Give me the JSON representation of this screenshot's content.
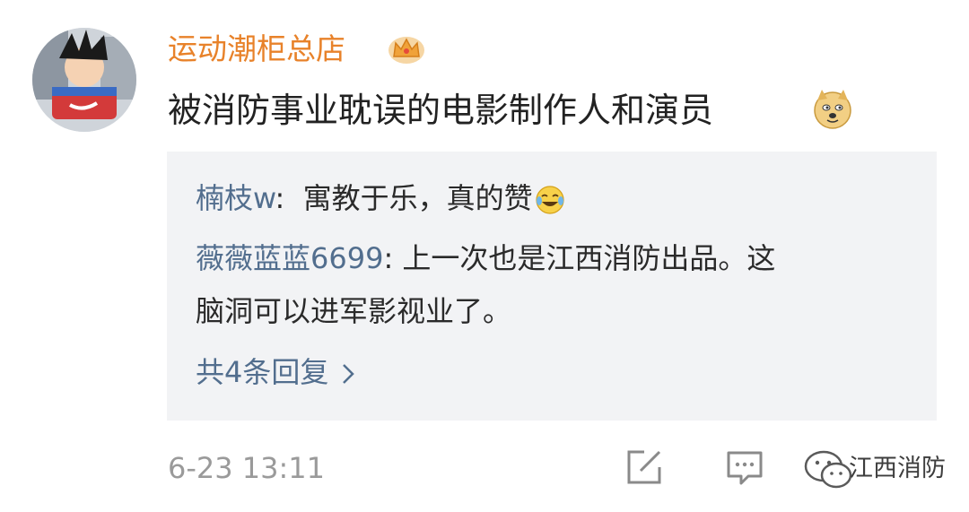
{
  "post": {
    "username": "运动潮柜总店",
    "badge_icon": "crown-icon",
    "text": "被消防事业耽误的电影制作人和演员",
    "emoji_icon": "doge-emoji-icon",
    "timestamp": "6-23 13:11"
  },
  "replies": [
    {
      "name": "楠枝w",
      "text": "寓教于乐，真的赞",
      "emoji_icon": "laugh-cry-emoji-icon"
    },
    {
      "name": "薇薇蓝蓝6699",
      "text": "上一次也是江西消防出品。这",
      "text_cont": "脑洞可以进军影视业了。"
    }
  ],
  "more_replies_label": "共4条回复",
  "actions": {
    "edit_icon": "edit-icon",
    "comment_icon": "comment-icon"
  },
  "watermark": {
    "text": "江西消防"
  },
  "colors": {
    "username": "#e8822a",
    "reply_name": "#526e8e",
    "reply_bg": "#f2f3f5",
    "timestamp": "#9a9a9a"
  }
}
